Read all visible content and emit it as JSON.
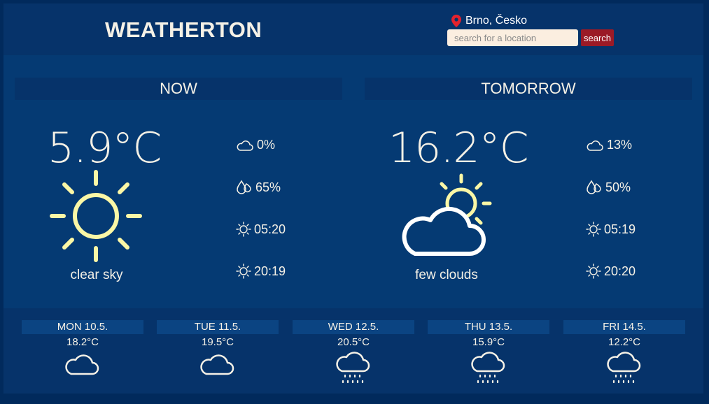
{
  "header": {
    "brand": "WEATHERTON",
    "location": "Brno, Česko",
    "search_placeholder": "search for a location",
    "search_button": "search"
  },
  "now": {
    "heading": "NOW",
    "temperature": "5.9°C",
    "description": "clear sky",
    "icon": "sun-icon",
    "clouds": "0%",
    "humidity": "65%",
    "sunrise": "05:20",
    "sunset": "20:19"
  },
  "tomorrow": {
    "heading": "TOMORROW",
    "temperature": "16.2°C",
    "description": "few clouds",
    "icon": "partly-cloudy-icon",
    "clouds": "13%",
    "humidity": "50%",
    "sunrise": "05:19",
    "sunset": "20:20"
  },
  "forecast": [
    {
      "day": "MON 10.5.",
      "temp": "18.2°C",
      "icon": "cloud-icon"
    },
    {
      "day": "TUE 11.5.",
      "temp": "19.5°C",
      "icon": "cloud-icon"
    },
    {
      "day": "WED 12.5.",
      "temp": "20.5°C",
      "icon": "rain-icon"
    },
    {
      "day": "THU 13.5.",
      "temp": "15.9°C",
      "icon": "rain-icon"
    },
    {
      "day": "FRI 14.5.",
      "temp": "12.2°C",
      "icon": "rain-icon"
    }
  ],
  "colors": {
    "page_background": "#012a5c",
    "panel_background": "#053a73",
    "header_background": "#06336a",
    "text": "#f5f1e6",
    "sun": "#fbf7a6",
    "search_button": "#9b1a26",
    "pin": "#e3222d"
  }
}
